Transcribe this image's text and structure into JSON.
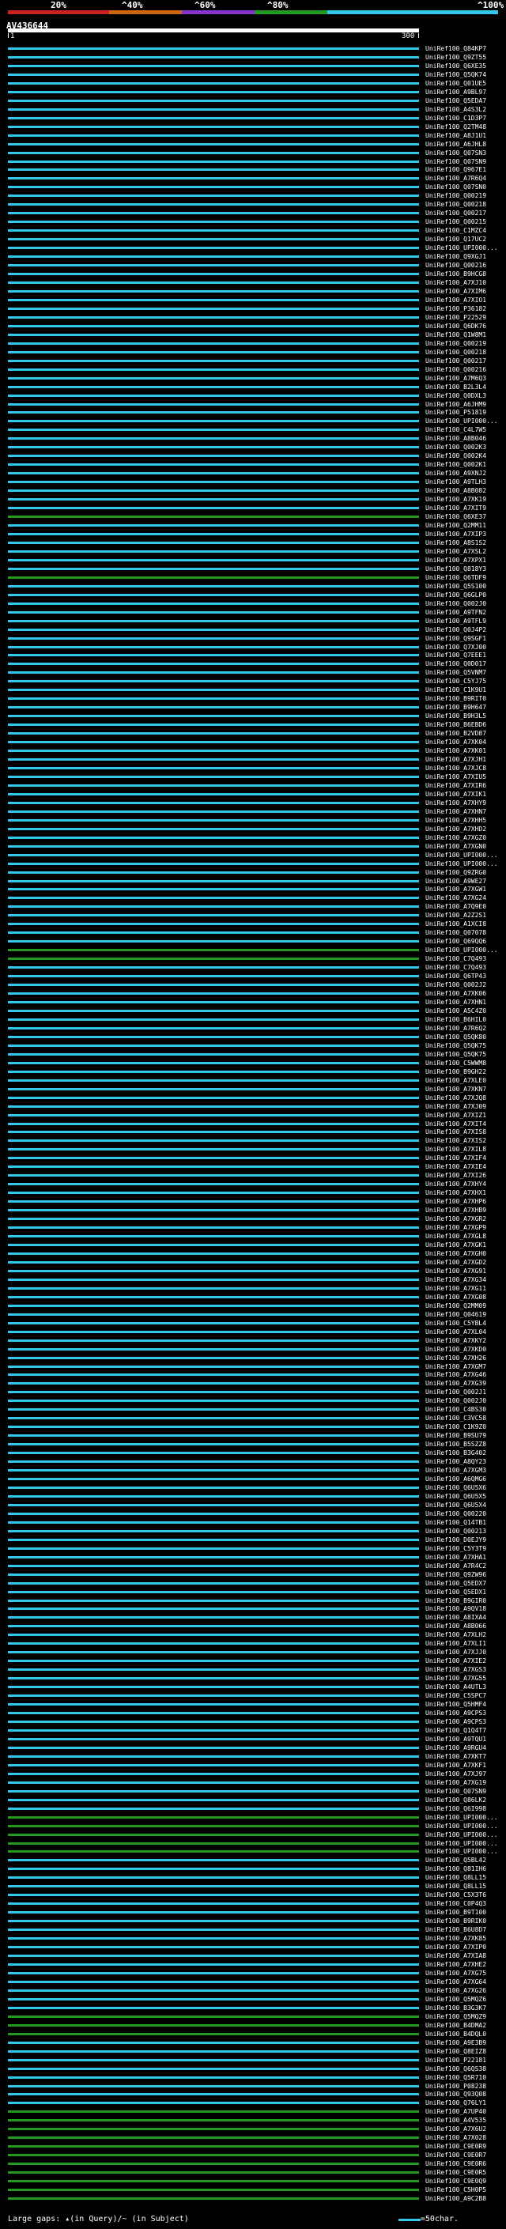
{
  "legend": {
    "labels": [
      "20%",
      "^40%",
      "^60%",
      "^80%",
      "^100%"
    ],
    "colors": [
      "#cc2222",
      "#cc6611",
      "#8833cc",
      "#229922",
      "#35c7e8"
    ]
  },
  "query": {
    "id": "AV436644",
    "start": "1",
    "end": "300"
  },
  "footer": {
    "gaps_text": "Large gaps: ▴(in Query)/~ (in Subject)",
    "scale_text": "=50char."
  },
  "hit_colors": {
    "cyan": "#35c7e8",
    "green": "#229922"
  },
  "hits": [
    {
      "label": "UniRef100_Q84KP7",
      "color": "cyan"
    },
    {
      "label": "UniRef100_Q9ZT55",
      "color": "cyan"
    },
    {
      "label": "UniRef100_Q6XE35",
      "color": "cyan"
    },
    {
      "label": "UniRef100_Q5QK74",
      "color": "cyan"
    },
    {
      "label": "UniRef100_Q01UE5",
      "color": "cyan"
    },
    {
      "label": "UniRef100_A9BL97",
      "color": "cyan"
    },
    {
      "label": "UniRef100_Q5EDA7",
      "color": "cyan"
    },
    {
      "label": "UniRef100_A4S3L2",
      "color": "cyan"
    },
    {
      "label": "UniRef100_C1D3P7",
      "color": "cyan"
    },
    {
      "label": "UniRef100_Q2TM48",
      "color": "cyan"
    },
    {
      "label": "UniRef100_A8J1U1",
      "color": "cyan"
    },
    {
      "label": "UniRef100_A6JHL8",
      "color": "cyan"
    },
    {
      "label": "UniRef100_Q07SN3",
      "color": "cyan"
    },
    {
      "label": "UniRef100_Q07SN9",
      "color": "cyan"
    },
    {
      "label": "UniRef100_Q967E1",
      "color": "cyan"
    },
    {
      "label": "UniRef100_A7R6Q4",
      "color": "cyan"
    },
    {
      "label": "UniRef100_Q07SN0",
      "color": "cyan"
    },
    {
      "label": "UniRef100_Q00219",
      "color": "cyan"
    },
    {
      "label": "UniRef100_Q00218",
      "color": "cyan"
    },
    {
      "label": "UniRef100_Q00217",
      "color": "cyan"
    },
    {
      "label": "UniRef100_Q00215",
      "color": "cyan"
    },
    {
      "label": "UniRef100_C1MZC4",
      "color": "cyan"
    },
    {
      "label": "UniRef100_Q17UC2",
      "color": "cyan"
    },
    {
      "label": "UniRef100_UPI000...",
      "color": "cyan"
    },
    {
      "label": "UniRef100_Q9XGJ1",
      "color": "cyan"
    },
    {
      "label": "UniRef100_Q00216",
      "color": "cyan"
    },
    {
      "label": "UniRef100_B9HCG8",
      "color": "cyan"
    },
    {
      "label": "UniRef100_A7XJ10",
      "color": "cyan"
    },
    {
      "label": "UniRef100_A7XIM6",
      "color": "cyan"
    },
    {
      "label": "UniRef100_A7XIO1",
      "color": "cyan"
    },
    {
      "label": "UniRef100_P36182",
      "color": "cyan"
    },
    {
      "label": "UniRef100_P22529",
      "color": "cyan"
    },
    {
      "label": "UniRef100_Q6DK76",
      "color": "cyan"
    },
    {
      "label": "UniRef100_Q1W8M1",
      "color": "cyan"
    },
    {
      "label": "UniRef100_Q00219",
      "color": "cyan"
    },
    {
      "label": "UniRef100_Q00218",
      "color": "cyan"
    },
    {
      "label": "UniRef100_Q00217",
      "color": "cyan"
    },
    {
      "label": "UniRef100_Q00216",
      "color": "cyan"
    },
    {
      "label": "UniRef100_A7M6Q3",
      "color": "cyan"
    },
    {
      "label": "UniRef100_B2L3L4",
      "color": "cyan"
    },
    {
      "label": "UniRef100_Q0DXL3",
      "color": "cyan"
    },
    {
      "label": "UniRef100_A6JHM9",
      "color": "cyan"
    },
    {
      "label": "UniRef100_P51819",
      "color": "cyan"
    },
    {
      "label": "UniRef100_UPI000...",
      "color": "cyan"
    },
    {
      "label": "UniRef100_C4L7W5",
      "color": "cyan"
    },
    {
      "label": "UniRef100_A8B046",
      "color": "cyan"
    },
    {
      "label": "UniRef100_Q002K3",
      "color": "cyan"
    },
    {
      "label": "UniRef100_Q002K4",
      "color": "cyan"
    },
    {
      "label": "UniRef100_Q002K1",
      "color": "cyan"
    },
    {
      "label": "UniRef100_A9XNJ2",
      "color": "cyan"
    },
    {
      "label": "UniRef100_A9TLH3",
      "color": "cyan"
    },
    {
      "label": "UniRef100_A8B082",
      "color": "cyan"
    },
    {
      "label": "UniRef100_A7XK19",
      "color": "cyan"
    },
    {
      "label": "UniRef100_A7XIT9",
      "color": "cyan"
    },
    {
      "label": "UniRef100_Q6XE37",
      "color": "green"
    },
    {
      "label": "UniRef100_Q2MM11",
      "color": "cyan"
    },
    {
      "label": "UniRef100_A7XIP3",
      "color": "cyan"
    },
    {
      "label": "UniRef100_A8S1S2",
      "color": "cyan"
    },
    {
      "label": "UniRef100_A7XSL2",
      "color": "cyan"
    },
    {
      "label": "UniRef100_A7XPX1",
      "color": "cyan"
    },
    {
      "label": "UniRef100_Q818Y3",
      "color": "cyan"
    },
    {
      "label": "UniRef100_Q6TDF9",
      "color": "green"
    },
    {
      "label": "UniRef100_Q5S100",
      "color": "cyan"
    },
    {
      "label": "UniRef100_Q6GLP0",
      "color": "cyan"
    },
    {
      "label": "UniRef100_Q002J0",
      "color": "cyan"
    },
    {
      "label": "UniRef100_A9TFN2",
      "color": "cyan"
    },
    {
      "label": "UniRef100_A9TFL9",
      "color": "cyan"
    },
    {
      "label": "UniRef100_Q0J4P2",
      "color": "cyan"
    },
    {
      "label": "UniRef100_Q9SGF1",
      "color": "cyan"
    },
    {
      "label": "UniRef100_Q7XJ00",
      "color": "cyan"
    },
    {
      "label": "UniRef100_Q7EEE1",
      "color": "cyan"
    },
    {
      "label": "UniRef100_Q0D017",
      "color": "cyan"
    },
    {
      "label": "UniRef100_Q5VNM7",
      "color": "cyan"
    },
    {
      "label": "UniRef100_C5YJ75",
      "color": "cyan"
    },
    {
      "label": "UniRef100_C1K9U1",
      "color": "cyan"
    },
    {
      "label": "UniRef100_B9RIT0",
      "color": "cyan"
    },
    {
      "label": "UniRef100_B9H647",
      "color": "cyan"
    },
    {
      "label": "UniRef100_B9H3L5",
      "color": "cyan"
    },
    {
      "label": "UniRef100_B6EBD6",
      "color": "cyan"
    },
    {
      "label": "UniRef100_B2VD87",
      "color": "cyan"
    },
    {
      "label": "UniRef100_A7XK04",
      "color": "cyan"
    },
    {
      "label": "UniRef100_A7XK01",
      "color": "cyan"
    },
    {
      "label": "UniRef100_A7XJH1",
      "color": "cyan"
    },
    {
      "label": "UniRef100_A7XJC8",
      "color": "cyan"
    },
    {
      "label": "UniRef100_A7XIU5",
      "color": "cyan"
    },
    {
      "label": "UniRef100_A7XIR6",
      "color": "cyan"
    },
    {
      "label": "UniRef100_A7XIK1",
      "color": "cyan"
    },
    {
      "label": "UniRef100_A7XHY9",
      "color": "cyan"
    },
    {
      "label": "UniRef100_A7XHN7",
      "color": "cyan"
    },
    {
      "label": "UniRef100_A7XHH5",
      "color": "cyan"
    },
    {
      "label": "UniRef100_A7XHD2",
      "color": "cyan"
    },
    {
      "label": "UniRef100_A7XGZ0",
      "color": "cyan"
    },
    {
      "label": "UniRef100_A7XGN0",
      "color": "cyan"
    },
    {
      "label": "UniRef100_UPI000...",
      "color": "cyan"
    },
    {
      "label": "UniRef100_UPI000...",
      "color": "cyan"
    },
    {
      "label": "UniRef100_Q9ZRG0",
      "color": "cyan"
    },
    {
      "label": "UniRef100_A9WE27",
      "color": "cyan"
    },
    {
      "label": "UniRef100_A7XGW1",
      "color": "cyan"
    },
    {
      "label": "UniRef100_A7XG24",
      "color": "cyan"
    },
    {
      "label": "UniRef100_A7Q9E0",
      "color": "cyan"
    },
    {
      "label": "UniRef100_A2Z2S1",
      "color": "cyan"
    },
    {
      "label": "UniRef100_A1XCI8",
      "color": "cyan"
    },
    {
      "label": "UniRef100_Q07078",
      "color": "cyan"
    },
    {
      "label": "UniRef100_Q69QQ6",
      "color": "cyan"
    },
    {
      "label": "UniRef100_UPI000...",
      "color": "green"
    },
    {
      "label": "UniRef100_C7Q493",
      "color": "green"
    },
    {
      "label": "UniRef100_C7Q493",
      "color": "cyan"
    },
    {
      "label": "UniRef100_Q6TP43",
      "color": "cyan"
    },
    {
      "label": "UniRef100_Q002J2",
      "color": "cyan"
    },
    {
      "label": "UniRef100_A7XK06",
      "color": "cyan"
    },
    {
      "label": "UniRef100_A7XHN1",
      "color": "cyan"
    },
    {
      "label": "UniRef100_A5C4Z0",
      "color": "cyan"
    },
    {
      "label": "UniRef100_B6HIL0",
      "color": "cyan"
    },
    {
      "label": "UniRef100_A7R6Q2",
      "color": "cyan"
    },
    {
      "label": "UniRef100_Q5QK80",
      "color": "cyan"
    },
    {
      "label": "UniRef100_Q5QK75",
      "color": "cyan"
    },
    {
      "label": "UniRef100_Q5QK75",
      "color": "cyan"
    },
    {
      "label": "UniRef100_C5WWM8",
      "color": "cyan"
    },
    {
      "label": "UniRef100_B9GH22",
      "color": "cyan"
    },
    {
      "label": "UniRef100_A7XLE0",
      "color": "cyan"
    },
    {
      "label": "UniRef100_A7XKN7",
      "color": "cyan"
    },
    {
      "label": "UniRef100_A7XJQ8",
      "color": "cyan"
    },
    {
      "label": "UniRef100_A7XJ09",
      "color": "cyan"
    },
    {
      "label": "UniRef100_A7XIZ1",
      "color": "cyan"
    },
    {
      "label": "UniRef100_A7XIT4",
      "color": "cyan"
    },
    {
      "label": "UniRef100_A7XIS8",
      "color": "cyan"
    },
    {
      "label": "UniRef100_A7XIS2",
      "color": "cyan"
    },
    {
      "label": "UniRef100_A7XIL8",
      "color": "cyan"
    },
    {
      "label": "UniRef100_A7XIF4",
      "color": "cyan"
    },
    {
      "label": "UniRef100_A7XIE4",
      "color": "cyan"
    },
    {
      "label": "UniRef100_A7XI26",
      "color": "cyan"
    },
    {
      "label": "UniRef100_A7XHY4",
      "color": "cyan"
    },
    {
      "label": "UniRef100_A7XHX1",
      "color": "cyan"
    },
    {
      "label": "UniRef100_A7XHP6",
      "color": "cyan"
    },
    {
      "label": "UniRef100_A7XHB9",
      "color": "cyan"
    },
    {
      "label": "UniRef100_A7XGR2",
      "color": "cyan"
    },
    {
      "label": "UniRef100_A7XGP9",
      "color": "cyan"
    },
    {
      "label": "UniRef100_A7XGL8",
      "color": "cyan"
    },
    {
      "label": "UniRef100_A7XGK1",
      "color": "cyan"
    },
    {
      "label": "UniRef100_A7XGH0",
      "color": "cyan"
    },
    {
      "label": "UniRef100_A7XGD2",
      "color": "cyan"
    },
    {
      "label": "UniRef100_A7XG91",
      "color": "cyan"
    },
    {
      "label": "UniRef100_A7XG34",
      "color": "cyan"
    },
    {
      "label": "UniRef100_A7XG11",
      "color": "cyan"
    },
    {
      "label": "UniRef100_A7XG08",
      "color": "cyan"
    },
    {
      "label": "UniRef100_Q2MM09",
      "color": "cyan"
    },
    {
      "label": "UniRef100_Q04619",
      "color": "cyan"
    },
    {
      "label": "UniRef100_C5YBL4",
      "color": "cyan"
    },
    {
      "label": "UniRef100_A7XL04",
      "color": "cyan"
    },
    {
      "label": "UniRef100_A7XKY2",
      "color": "cyan"
    },
    {
      "label": "UniRef100_A7XKD0",
      "color": "cyan"
    },
    {
      "label": "UniRef100_A7XH26",
      "color": "cyan"
    },
    {
      "label": "UniRef100_A7XGM7",
      "color": "cyan"
    },
    {
      "label": "UniRef100_A7XG46",
      "color": "cyan"
    },
    {
      "label": "UniRef100_A7XG39",
      "color": "cyan"
    },
    {
      "label": "UniRef100_Q002J1",
      "color": "cyan"
    },
    {
      "label": "UniRef100_Q002J0",
      "color": "cyan"
    },
    {
      "label": "UniRef100_C4BS30",
      "color": "cyan"
    },
    {
      "label": "UniRef100_C3VC58",
      "color": "cyan"
    },
    {
      "label": "UniRef100_C1K9Z0",
      "color": "cyan"
    },
    {
      "label": "UniRef100_B9SU79",
      "color": "cyan"
    },
    {
      "label": "UniRef100_B5SZZ8",
      "color": "cyan"
    },
    {
      "label": "UniRef100_B3G402",
      "color": "cyan"
    },
    {
      "label": "UniRef100_A8QY23",
      "color": "cyan"
    },
    {
      "label": "UniRef100_A7XGM3",
      "color": "cyan"
    },
    {
      "label": "UniRef100_A6QMG6",
      "color": "cyan"
    },
    {
      "label": "UniRef100_Q6U5X6",
      "color": "cyan"
    },
    {
      "label": "UniRef100_Q6U5X5",
      "color": "cyan"
    },
    {
      "label": "UniRef100_Q6U5X4",
      "color": "cyan"
    },
    {
      "label": "UniRef100_Q00220",
      "color": "cyan"
    },
    {
      "label": "UniRef100_Q14TB1",
      "color": "cyan"
    },
    {
      "label": "UniRef100_Q00213",
      "color": "cyan"
    },
    {
      "label": "UniRef100_D0EJY9",
      "color": "cyan"
    },
    {
      "label": "UniRef100_C5Y3T9",
      "color": "cyan"
    },
    {
      "label": "UniRef100_A7XHA1",
      "color": "cyan"
    },
    {
      "label": "UniRef100_A7R4C2",
      "color": "cyan"
    },
    {
      "label": "UniRef100_Q9ZW96",
      "color": "cyan"
    },
    {
      "label": "UniRef100_Q5EDX7",
      "color": "cyan"
    },
    {
      "label": "UniRef100_Q5EDX1",
      "color": "cyan"
    },
    {
      "label": "UniRef100_B9GIR0",
      "color": "cyan"
    },
    {
      "label": "UniRef100_A9QV18",
      "color": "cyan"
    },
    {
      "label": "UniRef100_A8IXA4",
      "color": "cyan"
    },
    {
      "label": "UniRef100_A8B066",
      "color": "cyan"
    },
    {
      "label": "UniRef100_A7XLH2",
      "color": "cyan"
    },
    {
      "label": "UniRef100_A7XLI1",
      "color": "cyan"
    },
    {
      "label": "UniRef100_A7XJJ0",
      "color": "cyan"
    },
    {
      "label": "UniRef100_A7XIE2",
      "color": "cyan"
    },
    {
      "label": "UniRef100_A7XGS3",
      "color": "cyan"
    },
    {
      "label": "UniRef100_A7XG55",
      "color": "cyan"
    },
    {
      "label": "UniRef100_A4UTL3",
      "color": "cyan"
    },
    {
      "label": "UniRef100_C5SPC7",
      "color": "cyan"
    },
    {
      "label": "UniRef100_Q5HMF4",
      "color": "cyan"
    },
    {
      "label": "UniRef100_A9CPS3",
      "color": "cyan"
    },
    {
      "label": "UniRef100_A9CPS3",
      "color": "cyan"
    },
    {
      "label": "UniRef100_Q1Q4T7",
      "color": "cyan"
    },
    {
      "label": "UniRef100_A9TQU1",
      "color": "cyan"
    },
    {
      "label": "UniRef100_A9RGU4",
      "color": "cyan"
    },
    {
      "label": "UniRef100_A7XKT7",
      "color": "cyan"
    },
    {
      "label": "UniRef100_A7XKF1",
      "color": "cyan"
    },
    {
      "label": "UniRef100_A7XJ97",
      "color": "cyan"
    },
    {
      "label": "UniRef100_A7XG19",
      "color": "cyan"
    },
    {
      "label": "UniRef100_Q07SN9",
      "color": "cyan"
    },
    {
      "label": "UniRef100_Q86LK2",
      "color": "cyan"
    },
    {
      "label": "UniRef100_Q6I998",
      "color": "cyan"
    },
    {
      "label": "UniRef100_UPI000...",
      "color": "green"
    },
    {
      "label": "UniRef100_UPI000...",
      "color": "green"
    },
    {
      "label": "UniRef100_UPI000...",
      "color": "green"
    },
    {
      "label": "UniRef100_UPI000...",
      "color": "green"
    },
    {
      "label": "UniRef100_UPI000...",
      "color": "green"
    },
    {
      "label": "UniRef100_Q5BL42",
      "color": "cyan"
    },
    {
      "label": "UniRef100_Q81IH6",
      "color": "cyan"
    },
    {
      "label": "UniRef100_Q8LL15",
      "color": "cyan"
    },
    {
      "label": "UniRef100_Q8LL15",
      "color": "cyan"
    },
    {
      "label": "UniRef100_C5X3T6",
      "color": "cyan"
    },
    {
      "label": "UniRef100_C0P4Q3",
      "color": "cyan"
    },
    {
      "label": "UniRef100_B9T100",
      "color": "cyan"
    },
    {
      "label": "UniRef100_B9RIK0",
      "color": "cyan"
    },
    {
      "label": "UniRef100_B6U8D7",
      "color": "cyan"
    },
    {
      "label": "UniRef100_A7XK85",
      "color": "cyan"
    },
    {
      "label": "UniRef100_A7XIP0",
      "color": "cyan"
    },
    {
      "label": "UniRef100_A7XIA8",
      "color": "cyan"
    },
    {
      "label": "UniRef100_A7XHE2",
      "color": "cyan"
    },
    {
      "label": "UniRef100_A7XG75",
      "color": "cyan"
    },
    {
      "label": "UniRef100_A7XG64",
      "color": "cyan"
    },
    {
      "label": "UniRef100_A7XG26",
      "color": "cyan"
    },
    {
      "label": "UniRef100_Q5MQZ6",
      "color": "cyan"
    },
    {
      "label": "UniRef100_B3G3K7",
      "color": "cyan"
    },
    {
      "label": "UniRef100_Q5MQZ9",
      "color": "green"
    },
    {
      "label": "UniRef100_B4DMA2",
      "color": "green"
    },
    {
      "label": "UniRef100_B4DQL0",
      "color": "green"
    },
    {
      "label": "UniRef100_A9E3B9",
      "color": "cyan"
    },
    {
      "label": "UniRef100_Q8EIZ8",
      "color": "cyan"
    },
    {
      "label": "UniRef100_P22181",
      "color": "cyan"
    },
    {
      "label": "UniRef100_Q6QS38",
      "color": "cyan"
    },
    {
      "label": "UniRef100_Q5R710",
      "color": "cyan"
    },
    {
      "label": "UniRef100_P08238",
      "color": "cyan"
    },
    {
      "label": "UniRef100_Q93Q08",
      "color": "cyan"
    },
    {
      "label": "UniRef100_Q76LY1",
      "color": "cyan"
    },
    {
      "label": "UniRef100_A7UP40",
      "color": "green"
    },
    {
      "label": "UniRef100_A4V535",
      "color": "green"
    },
    {
      "label": "UniRef100_A7X6U2",
      "color": "green"
    },
    {
      "label": "UniRef100_A7X028",
      "color": "green"
    },
    {
      "label": "UniRef100_C9E0R9",
      "color": "green"
    },
    {
      "label": "UniRef100_C9E0R7",
      "color": "green"
    },
    {
      "label": "UniRef100_C9E0R6",
      "color": "green"
    },
    {
      "label": "UniRef100_C9E0R5",
      "color": "green"
    },
    {
      "label": "UniRef100_C9E0Q9",
      "color": "green"
    },
    {
      "label": "UniRef100_C5H0P5",
      "color": "green"
    },
    {
      "label": "UniRef100_A9C2B8",
      "color": "green"
    }
  ]
}
